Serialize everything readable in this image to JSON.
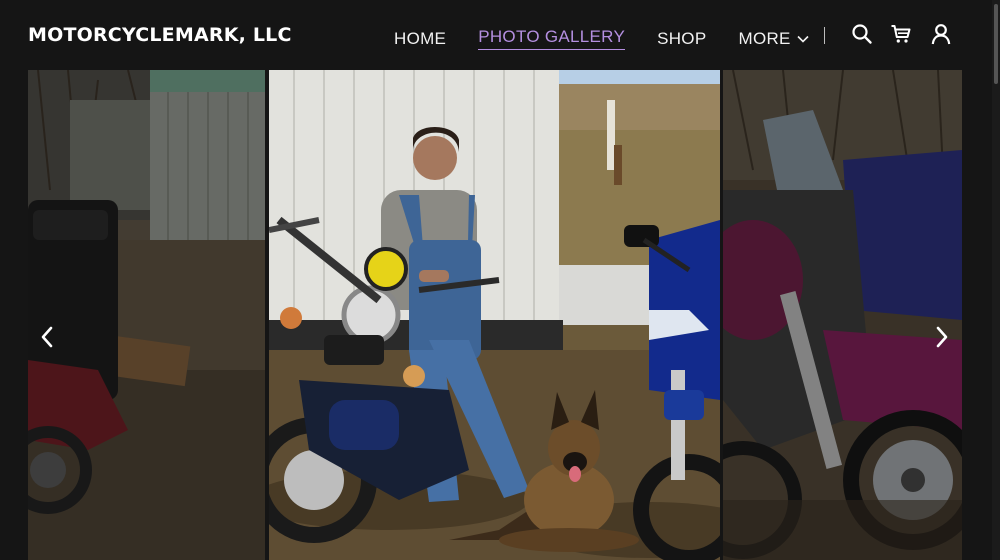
{
  "header": {
    "logo": "MOTORCYCLEMARK, LLC",
    "nav": [
      {
        "label": "HOME",
        "active": false
      },
      {
        "label": "PHOTO GALLERY",
        "active": true
      },
      {
        "label": "SHOP",
        "active": false
      },
      {
        "label": "MORE",
        "active": false
      }
    ]
  },
  "icons": {
    "search": "search-icon",
    "cart": "cart-icon",
    "account": "account-icon",
    "prev": "chevron-left-icon",
    "next": "chevron-right-icon",
    "more": "chevron-down-icon"
  },
  "gallery": {
    "images": [
      {
        "position": "previous",
        "description": "motorcycle parked beside a gray metal shed"
      },
      {
        "position": "current",
        "description": "man in overalls leaning on a motorcycle with a german shepherd"
      },
      {
        "position": "next",
        "description": "row of parked motorcycles"
      }
    ]
  },
  "colors": {
    "background": "#151515",
    "accent": "#b48fe0",
    "text": "#f2f2f2"
  }
}
